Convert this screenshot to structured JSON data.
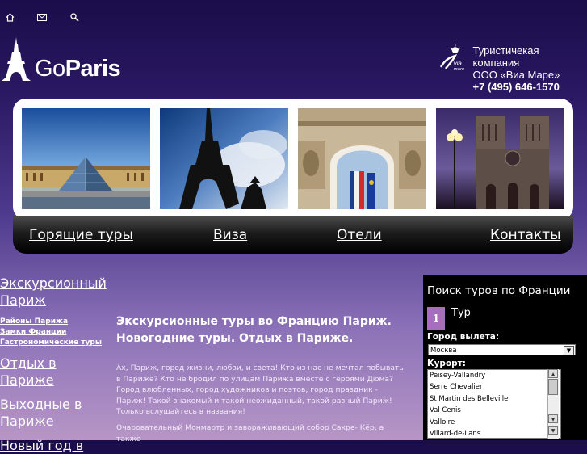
{
  "top_icons": [
    "home-icon",
    "mail-icon",
    "search-icon"
  ],
  "logo": {
    "brand_light": "Go",
    "brand_bold": "Paris"
  },
  "company": {
    "line1": "Туристичекая компания",
    "line2": "ООО «Виа Маре»",
    "phone": "+7 (495) 646-1570"
  },
  "gallery": {
    "photos": [
      "louvre-photo",
      "eiffel-tower-photo",
      "arc-de-triomphe-photo",
      "notre-dame-photo"
    ]
  },
  "nav": {
    "items": [
      "Горящие туры",
      "Виза",
      "Отели",
      "Контакты"
    ]
  },
  "leftnav": {
    "section1": "Экскурсионный Париж",
    "sub": [
      "Районы Парижа",
      "Замки Франции",
      "Гастрономические туры"
    ],
    "section2": "Отдых в Париже",
    "section3": "Выходные в Париже",
    "section4": "Новый год в"
  },
  "main": {
    "heading": "Экскурсионные туры во Францию Париж. Новогодние туры. Отдых в Париже.",
    "paragraph1": "Ах, Париж, город жизни, любви, и света! Кто из нас не мечтал побывать в Париже? Кто не бродил по улицам Парижа вместе с героями Дюма? Город влюбленных, город художников и поэтов, город праздник - Париж! Такой знакомый и такой неожиданный, такой разный Париж! Только вслушайтесь в названия!",
    "paragraph2": "Очаровательный Монмартр и завораживающий собор Сакре- Кёр, а также"
  },
  "search": {
    "title": "Поиск туров по Франции",
    "step": "1",
    "step_label": "Тур",
    "departure_label": "Город вылета:",
    "departure_value": "Москва",
    "resort_label": "Курорт:",
    "resorts": [
      "Peisey-Vallandry",
      "Serre Chevalier",
      "St Martin des Belleville",
      "Val Cenis",
      "Valloire",
      "Villard-de-Lans"
    ]
  },
  "colors": {
    "accent": "#a56fbe",
    "nav_bg": "#000000"
  }
}
